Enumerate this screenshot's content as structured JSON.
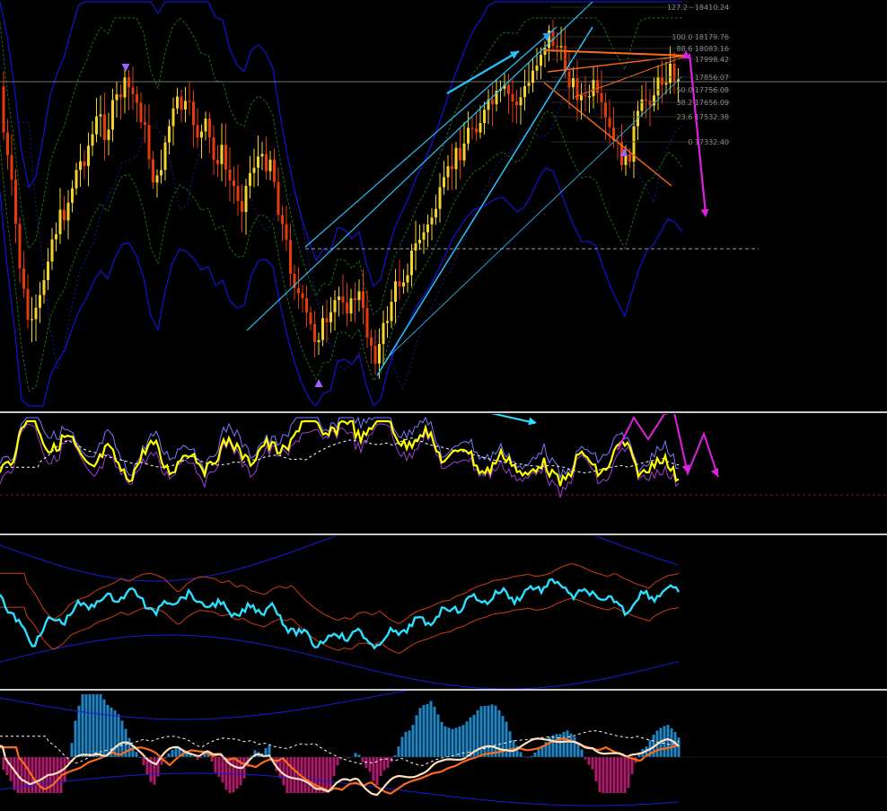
{
  "chart_data": [
    {
      "type": "candlestick",
      "title": "",
      "series_shape": [
        [
          4,
          18
        ],
        [
          14,
          40
        ],
        [
          24,
          70
        ],
        [
          34,
          88
        ],
        [
          44,
          78
        ],
        [
          54,
          58
        ],
        [
          64,
          50
        ],
        [
          74,
          44
        ],
        [
          84,
          32
        ],
        [
          94,
          26
        ],
        [
          102,
          20
        ],
        [
          110,
          12
        ],
        [
          118,
          18
        ],
        [
          126,
          10
        ],
        [
          134,
          4
        ],
        [
          142,
          2
        ],
        [
          150,
          6
        ],
        [
          158,
          12
        ],
        [
          166,
          26
        ],
        [
          174,
          38
        ],
        [
          182,
          24
        ],
        [
          190,
          14
        ],
        [
          198,
          8
        ],
        [
          206,
          10
        ],
        [
          214,
          12
        ],
        [
          222,
          20
        ],
        [
          230,
          16
        ],
        [
          238,
          28
        ],
        [
          246,
          24
        ],
        [
          254,
          34
        ],
        [
          262,
          38
        ],
        [
          270,
          42
        ],
        [
          278,
          32
        ],
        [
          286,
          26
        ],
        [
          294,
          30
        ],
        [
          300,
          24
        ],
        [
          306,
          36
        ],
        [
          314,
          50
        ],
        [
          322,
          62
        ],
        [
          330,
          72
        ],
        [
          338,
          80
        ],
        [
          346,
          86
        ],
        [
          352,
          90
        ],
        [
          358,
          84
        ],
        [
          366,
          88
        ],
        [
          374,
          76
        ],
        [
          382,
          74
        ],
        [
          390,
          80
        ],
        [
          398,
          72
        ],
        [
          406,
          84
        ],
        [
          414,
          92
        ],
        [
          420,
          96
        ],
        [
          428,
          86
        ],
        [
          436,
          76
        ],
        [
          444,
          70
        ],
        [
          452,
          66
        ],
        [
          460,
          60
        ],
        [
          468,
          54
        ],
        [
          476,
          52
        ],
        [
          484,
          44
        ],
        [
          492,
          40
        ],
        [
          500,
          32
        ],
        [
          508,
          26
        ],
        [
          516,
          22
        ],
        [
          524,
          16
        ],
        [
          532,
          14
        ],
        [
          540,
          12
        ],
        [
          548,
          8
        ],
        [
          556,
          6
        ],
        [
          564,
          4
        ],
        [
          572,
          8
        ],
        [
          580,
          6
        ],
        [
          588,
          2
        ],
        [
          596,
          -6
        ],
        [
          604,
          -12
        ],
        [
          612,
          -16
        ],
        [
          620,
          -12
        ],
        [
          628,
          -6
        ],
        [
          636,
          0
        ],
        [
          644,
          4
        ],
        [
          652,
          8
        ],
        [
          660,
          2
        ],
        [
          668,
          10
        ],
        [
          676,
          16
        ],
        [
          684,
          22
        ],
        [
          692,
          26
        ],
        [
          698,
          30
        ],
        [
          704,
          20
        ],
        [
          712,
          12
        ],
        [
          720,
          6
        ],
        [
          728,
          4
        ],
        [
          736,
          0
        ],
        [
          744,
          -4
        ],
        [
          752,
          -2
        ],
        [
          756,
          2
        ]
      ],
      "fibonacci_levels": [
        {
          "ratio": "127.2",
          "value": "18410.24"
        },
        {
          "ratio": "100.0",
          "value": "18179.76"
        },
        {
          "ratio": "88.6",
          "value": "18083.16"
        },
        {
          "ratio": "",
          "value": "17998.42"
        },
        {
          "ratio": "",
          "value": "17856.07"
        },
        {
          "ratio": "50.0",
          "value": "17756.08"
        },
        {
          "ratio": "38.2",
          "value": "17656.09"
        },
        {
          "ratio": "23.6",
          "value": "17532.38"
        },
        {
          "ratio": "0",
          "value": "17332.40"
        }
      ],
      "fibonacci_labels": [
        "127.2 - 18410.24",
        "100.0  18179.76",
        "88.6  18083.16",
        "17998.42",
        "17856.07",
        "50.0  17756.08",
        "38.2  17656.09",
        "23.6  17532.38",
        "0  17332.40"
      ],
      "colors": {
        "up": "#f5d22a",
        "down": "#e63a0c",
        "bollinger_outer": "#1212d8",
        "bollinger_inner": "#1b6b1b",
        "trendline": "#29c4ff",
        "wedge": "#ff6a1a",
        "forecast": "#e020e0"
      },
      "grid": false,
      "legend": "none"
    },
    {
      "type": "line",
      "name_hidden": true,
      "series": [
        {
          "color": "#ffff00",
          "values": [
            42,
            38,
            55,
            62,
            48,
            40,
            45,
            58,
            66,
            60,
            50,
            44,
            40,
            50,
            62,
            58,
            46,
            38,
            44,
            54,
            48,
            36,
            30,
            34,
            44,
            52,
            58,
            60,
            50,
            42,
            36,
            30,
            28,
            34,
            42,
            48,
            60,
            66,
            64,
            56,
            50,
            40,
            30,
            34,
            44,
            52,
            46,
            40,
            36,
            46,
            58,
            60,
            48,
            40,
            34,
            48,
            56,
            52,
            40,
            30
          ]
        },
        {
          "color": "#8888ff",
          "values": []
        }
      ],
      "colors": {
        "signal": "#ffffff",
        "zero_line": "#b01050"
      },
      "grid": false,
      "legend": "none"
    },
    {
      "type": "line",
      "series": [
        {
          "color": "#29e0ff",
          "values": []
        }
      ],
      "colors": {
        "bands": "#1a1adc",
        "envelope": "#d03a14"
      },
      "grid": false,
      "legend": "none"
    },
    {
      "type": "bar",
      "series": [
        {
          "color": "#1f86c6",
          "values": []
        },
        {
          "color": "#b01a6c",
          "values": []
        }
      ],
      "colors": {
        "fast": "#ffe0c0",
        "slow": "#ff6a1a",
        "signal": "#ffffff",
        "bands": "#1a1adc"
      },
      "grid": false,
      "legend": "none"
    }
  ]
}
